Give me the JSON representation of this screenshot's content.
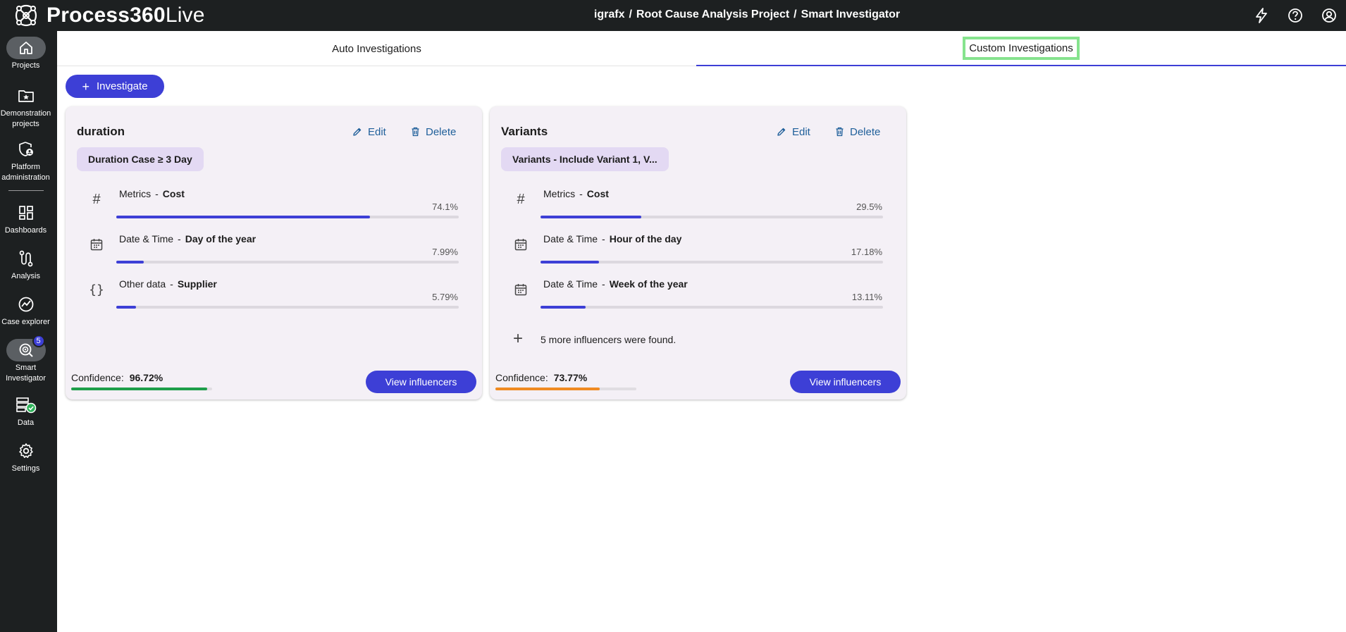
{
  "app": {
    "brand_bold": "Process360",
    "brand_light": "Live"
  },
  "breadcrumb": [
    "igrafx",
    "Root Cause Analysis Project",
    "Smart Investigator"
  ],
  "breadcrumb_sep": "/",
  "header_icons": [
    "lightning-icon",
    "help-icon",
    "account-icon"
  ],
  "sidebar": {
    "items": [
      {
        "label": "Projects",
        "icon": "home-icon",
        "active": true
      },
      {
        "label": "Demonstration projects",
        "icon": "star-folder-icon"
      },
      {
        "label": "Platform administration",
        "icon": "admin-shield-icon"
      },
      {
        "label": "Dashboards",
        "icon": "dashboard-icon"
      },
      {
        "label": "Analysis",
        "icon": "analysis-icon"
      },
      {
        "label": "Case explorer",
        "icon": "case-explorer-icon"
      },
      {
        "label": "Smart Investigator",
        "icon": "smart-investigator-icon",
        "badge": "5",
        "active": true
      },
      {
        "label": "Data",
        "icon": "data-icon"
      },
      {
        "label": "Settings",
        "icon": "gear-icon"
      }
    ]
  },
  "tabs": [
    {
      "label": "Auto Investigations",
      "selected": false
    },
    {
      "label": "Custom Investigations",
      "selected": true
    }
  ],
  "investigate_button": {
    "label": "Investigate"
  },
  "cards": [
    {
      "title": "duration",
      "edit_label": "Edit",
      "delete_label": "Delete",
      "filter": "Duration Case ≥ 3 Day",
      "influencers": [
        {
          "category": "Metrics",
          "name": "Cost",
          "percent": "74.1%",
          "value": 0.741,
          "icon": "hash-icon"
        },
        {
          "category": "Date & Time",
          "name": "Day of the year",
          "percent": "7.99%",
          "value": 0.0799,
          "icon": "calendar-icon"
        },
        {
          "category": "Other data",
          "name": "Supplier",
          "percent": "5.79%",
          "value": 0.0579,
          "icon": "braces-icon"
        }
      ],
      "more_text": "",
      "confidence_label": "Confidence:",
      "confidence": "96.72%",
      "confidence_value": 0.9672,
      "confidence_color": "#1e9e4a",
      "view_button": "View influencers"
    },
    {
      "title": "Variants",
      "edit_label": "Edit",
      "delete_label": "Delete",
      "filter": "Variants - Include Variant 1, V...",
      "influencers": [
        {
          "category": "Metrics",
          "name": "Cost",
          "percent": "29.5%",
          "value": 0.295,
          "icon": "hash-icon"
        },
        {
          "category": "Date & Time",
          "name": "Hour of the day",
          "percent": "17.18%",
          "value": 0.1718,
          "icon": "calendar-icon"
        },
        {
          "category": "Date & Time",
          "name": "Week of the year",
          "percent": "13.11%",
          "value": 0.1311,
          "icon": "calendar-icon"
        }
      ],
      "more_text": "5 more influencers were found.",
      "confidence_label": "Confidence:",
      "confidence": "73.77%",
      "confidence_value": 0.7377,
      "confidence_color": "#ef8a22",
      "view_button": "View influencers"
    }
  ],
  "colors": {
    "accent": "#3d3fd6",
    "topbar": "#1d2021",
    "card_bg": "#f4f0f6",
    "chip_bg": "#e3d9f3",
    "focus_outline": "#86e38e"
  }
}
